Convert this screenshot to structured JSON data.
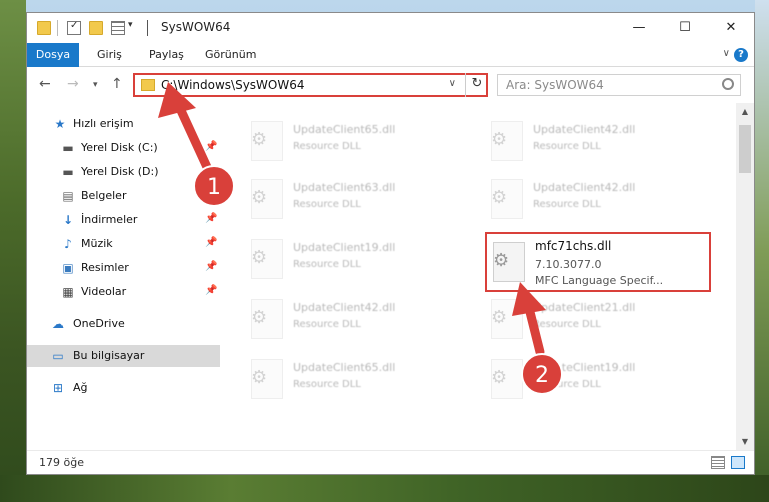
{
  "window": {
    "title": "SysWOW64",
    "controls": {
      "minimize": "—",
      "maximize": "☐",
      "close": "✕"
    }
  },
  "ribbon": {
    "tabs": [
      "Dosya",
      "Giriş",
      "Paylaş",
      "Görünüm"
    ]
  },
  "nav": {
    "address": "C:\\Windows\\SysWOW64",
    "search_placeholder": "Ara: SysWOW64"
  },
  "sidebar": {
    "quick_access": "Hızlı erişim",
    "items": [
      {
        "label": "Yerel Disk (C:)",
        "pinned": true
      },
      {
        "label": "Yerel Disk (D:)",
        "pinned": false
      },
      {
        "label": "Belgeler",
        "pinned": false
      },
      {
        "label": "İndirmeler",
        "pinned": true
      },
      {
        "label": "Müzik",
        "pinned": true
      },
      {
        "label": "Resimler",
        "pinned": true
      },
      {
        "label": "Videolar",
        "pinned": true
      }
    ],
    "onedrive": "OneDrive",
    "this_pc": "Bu bilgisayar",
    "network": "Ağ"
  },
  "files": [
    {
      "name": "UpdateClient65.dll",
      "type": "Resource DLL"
    },
    {
      "name": "UpdateClient42.dll",
      "type": "Resource DLL"
    },
    {
      "name": "UpdateClient63.dll",
      "type": "Resource DLL"
    },
    {
      "name": "UpdateClient42.dll",
      "type": "Resource DLL"
    },
    {
      "name": "UpdateClient19.dll",
      "type": "Resource DLL"
    },
    {
      "name": "mfc71chs.dll",
      "version": "7.10.3077.0",
      "description": "MFC Language Specif..."
    },
    {
      "name": "UpdateClient42.dll",
      "type": "Resource DLL"
    },
    {
      "name": "UpdateClient21.dll",
      "type": "Resource DLL"
    },
    {
      "name": "UpdateClient65.dll",
      "type": "Resource DLL"
    },
    {
      "name": "UpdateClient19.dll",
      "type": "Resource DLL"
    }
  ],
  "status": {
    "item_count": "179 öğe"
  },
  "annotations": {
    "step1": "1",
    "step2": "2",
    "color": "#d9403a"
  }
}
